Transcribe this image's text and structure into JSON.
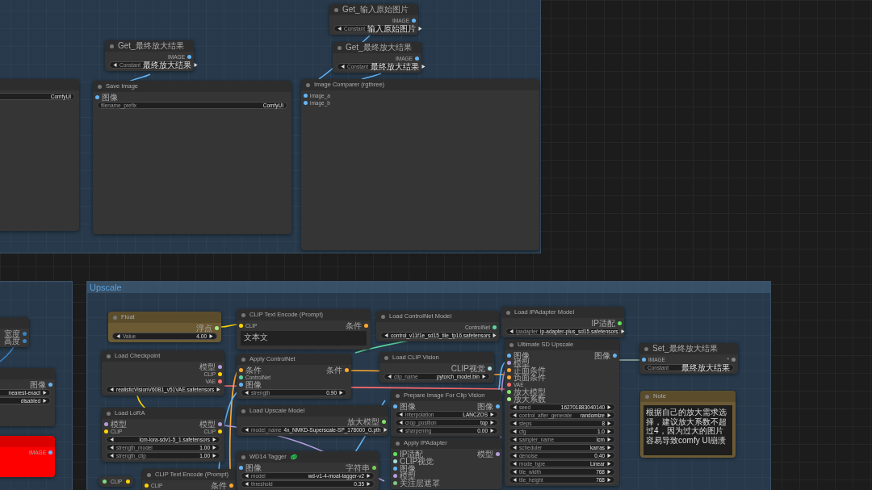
{
  "groups": [
    {
      "title": "Upscale"
    }
  ],
  "nodes": [
    {
      "kind": "node",
      "color": "#353535",
      "widgets": [
        {
          "kind": "text",
          "value": "ComfyUI"
        }
      ]
    },
    {
      "kind": "node",
      "title": "Get_最终放大结果",
      "color": "#353535",
      "outputs": [
        {
          "label": "IMAGE",
          "color": "#64b5f6"
        }
      ],
      "widgets": [
        {
          "kind": "combo",
          "name": "Constant",
          "value": "最终放大结果"
        }
      ]
    },
    {
      "kind": "node",
      "title": "Save Image",
      "color": "#353535",
      "inputs": [
        {
          "label": "图像",
          "color": "#64b5f6"
        }
      ],
      "widgets": [
        {
          "kind": "text",
          "name": "filename_prefix",
          "value": "ComfyUI"
        }
      ]
    },
    {
      "kind": "node",
      "title": "Get_输入原始图片",
      "color": "#353535",
      "outputs": [
        {
          "label": "IMAGE",
          "color": "#64b5f6"
        }
      ],
      "widgets": [
        {
          "kind": "combo",
          "name": "Constant",
          "value": "输入原始图片"
        }
      ]
    },
    {
      "kind": "node",
      "title": "Get_最终放大结果",
      "color": "#353535",
      "outputs": [
        {
          "label": "IMAGE",
          "color": "#64b5f6"
        }
      ],
      "widgets": [
        {
          "kind": "combo",
          "name": "Constant",
          "value": "最终放大结果"
        }
      ]
    },
    {
      "kind": "node",
      "title": "Image Comparer (rgthree)",
      "color": "#353535",
      "inputs": [
        {
          "label": "image_a",
          "color": "#64b5f6"
        },
        {
          "label": "image_b",
          "color": "#64b5f6"
        }
      ]
    },
    {
      "kind": "node",
      "color": "#353535",
      "outputs": [
        {
          "label": "宽度",
          "color": "#3b82c4"
        },
        {
          "label": "高度",
          "color": "#3b82c4"
        }
      ]
    },
    {
      "kind": "node",
      "color": "#353535",
      "outputs": [
        {
          "label": "图像",
          "color": "#64b5f6"
        }
      ],
      "widgets": [
        {
          "kind": "combo",
          "value": "nearest-exact"
        },
        {
          "kind": "combo",
          "value": "disabled"
        }
      ]
    },
    {
      "kind": "node",
      "color": "#ff0000",
      "outputs": [
        {
          "label": "IMAGE",
          "color": "#64b5f6"
        }
      ]
    },
    {
      "kind": "node",
      "title": "Float",
      "color": "#6b5a34",
      "outputs": [
        {
          "label": "浮点",
          "color": "#aaee88"
        }
      ],
      "widgets": [
        {
          "kind": "combo",
          "name": "Value",
          "value": "4.00"
        }
      ]
    },
    {
      "kind": "node",
      "title": "Load Checkpoint",
      "color": "#353535",
      "outputs": [
        {
          "label": "模型",
          "color": "#b39ddb"
        },
        {
          "label": "CLIP",
          "color": "#ffd500"
        },
        {
          "label": "VAE",
          "color": "#ff6e6e"
        }
      ],
      "widgets": [
        {
          "kind": "combo",
          "value": "realisticVisionV60B1_v51VAE.safetensors"
        }
      ]
    },
    {
      "kind": "node",
      "title": "Load LoRA",
      "color": "#353535",
      "inputs": [
        {
          "label": "模型",
          "color": "#b39ddb"
        },
        {
          "label": "CLIP",
          "color": "#ffd500"
        }
      ],
      "outputs": [
        {
          "label": "模型",
          "color": "#b39ddb"
        },
        {
          "label": "CLIP",
          "color": "#ffd500"
        }
      ],
      "widgets": [
        {
          "kind": "combo",
          "value": "lcm-lora-sdv1-5_1.safetensors"
        },
        {
          "kind": "combo",
          "name": "strength_model",
          "value": "1.00"
        },
        {
          "kind": "combo",
          "name": "strength_clip",
          "value": "1.00"
        }
      ]
    },
    {
      "kind": "reroute",
      "label": "CLIP",
      "inputs": [
        {
          "color": "#7fdc7f"
        }
      ],
      "outputs": [
        {
          "color": "#ffd500"
        }
      ]
    },
    {
      "kind": "node",
      "title": "CLIP Text Encode (Prompt)",
      "color": "#353535",
      "inputs": [
        {
          "label": "CLIP",
          "color": "#ffd500"
        }
      ],
      "outputs": [
        {
          "label": "条件",
          "color": "#ffa931"
        }
      ]
    },
    {
      "kind": "node",
      "title": "CLIP Text Encode (Prompt)",
      "color": "#353535",
      "inputs": [
        {
          "label": "CLIP",
          "color": "#ffd500"
        }
      ],
      "outputs": [
        {
          "label": "条件",
          "color": "#ffa931"
        }
      ],
      "widgets": [
        {
          "kind": "textarea",
          "value": "文本文"
        }
      ]
    },
    {
      "kind": "node",
      "title": "Apply ControlNet",
      "color": "#353535",
      "inputs": [
        {
          "label": "条件",
          "color": "#ffa931"
        },
        {
          "label": "ControlNet",
          "color": "#5fd3a0"
        },
        {
          "label": "图像",
          "color": "#64b5f6"
        }
      ],
      "outputs": [
        {
          "label": "条件",
          "color": "#ffa931"
        }
      ],
      "widgets": [
        {
          "kind": "combo",
          "name": "strength",
          "value": "0.90"
        }
      ]
    },
    {
      "kind": "node",
      "title": "Load Upscale Model",
      "color": "#353535",
      "outputs": [
        {
          "label": "放大模型",
          "color": "#7ee36a"
        }
      ],
      "widgets": [
        {
          "kind": "combo",
          "name": "model_name",
          "value": "4x_NMKD-Superscale-SP_178000_G.pth"
        }
      ]
    },
    {
      "kind": "node",
      "title": "WD14 Tagger",
      "badge": true,
      "color": "#353535",
      "inputs": [
        {
          "label": "图像",
          "color": "#64b5f6"
        }
      ],
      "outputs": [
        {
          "label": "字符串",
          "color": "#77cc55"
        }
      ],
      "widgets": [
        {
          "kind": "combo",
          "name": "model",
          "value": "wd-v1-4-moat-tagger-v2"
        },
        {
          "kind": "combo",
          "name": "threshold",
          "value": "0.35"
        }
      ]
    },
    {
      "kind": "node",
      "title": "Load ControlNet Model",
      "color": "#353535",
      "outputs": [
        {
          "label": "ControlNet",
          "color": "#5fd3a0"
        }
      ],
      "widgets": [
        {
          "kind": "combo",
          "value": "control_v11f1e_sd15_tile_fp16.safetensors"
        }
      ]
    },
    {
      "kind": "node",
      "title": "Load CLIP Vision",
      "color": "#353535",
      "outputs": [
        {
          "label": "CLIP视觉",
          "color": "#a8dadc"
        }
      ],
      "widgets": [
        {
          "kind": "combo",
          "name": "clip_name",
          "value": "pytorch_model.bin"
        }
      ]
    },
    {
      "kind": "node",
      "title": "Prepare Image For Clip Vision",
      "color": "#353535",
      "inputs": [
        {
          "label": "图像",
          "color": "#64b5f6"
        }
      ],
      "outputs": [
        {
          "label": "图像",
          "color": "#64b5f6"
        }
      ],
      "widgets": [
        {
          "kind": "combo",
          "name": "interpolation",
          "value": "LANCZOS"
        },
        {
          "kind": "combo",
          "name": "crop_position",
          "value": "top"
        },
        {
          "kind": "combo",
          "name": "sharpening",
          "value": "0.00"
        }
      ]
    },
    {
      "kind": "node",
      "title": "Apply IPAdapter",
      "color": "#353535",
      "inputs": [
        {
          "label": "IP适配",
          "color": "#5ee35e"
        },
        {
          "label": "CLIP视觉",
          "color": "#a8dadc"
        },
        {
          "label": "图像",
          "color": "#64b5f6"
        },
        {
          "label": "模型",
          "color": "#b39ddb"
        },
        {
          "label": "关注层遮罩",
          "color": "#81c784"
        }
      ],
      "outputs": [
        {
          "label": "模型",
          "color": "#b39ddb"
        }
      ]
    },
    {
      "kind": "node",
      "title": "Load IPAdapter Model",
      "color": "#353535",
      "outputs": [
        {
          "label": "IP适配",
          "color": "#5ee35e"
        }
      ],
      "widgets": [
        {
          "kind": "combo",
          "name": "ipadapter",
          "value": "ip-adapter-plus_sd15.safetensors"
        }
      ]
    },
    {
      "kind": "node",
      "title": "Ultimate SD Upscale",
      "color": "#353535",
      "inputs": [
        {
          "label": "图像",
          "color": "#64b5f6"
        },
        {
          "label": "模型",
          "color": "#b39ddb"
        },
        {
          "label": "正面条件",
          "color": "#ffa931"
        },
        {
          "label": "负面条件",
          "color": "#ffa931"
        },
        {
          "label": "VAE",
          "color": "#ff6e6e"
        },
        {
          "label": "放大模型",
          "color": "#7ee36a"
        },
        {
          "label": "放大系数",
          "color": "#aaee88"
        }
      ],
      "outputs": [
        {
          "label": "图像",
          "color": "#64b5f6"
        }
      ],
      "widgets": [
        {
          "kind": "combo",
          "name": "seed",
          "value": "162701883040140"
        },
        {
          "kind": "combo",
          "name": "control_after_generate",
          "value": "randomize"
        },
        {
          "kind": "combo",
          "name": "steps",
          "value": "8"
        },
        {
          "kind": "combo",
          "name": "cfg",
          "value": "1.0"
        },
        {
          "kind": "combo",
          "name": "sampler_name",
          "value": "lcm"
        },
        {
          "kind": "combo",
          "name": "scheduler",
          "value": "karras"
        },
        {
          "kind": "combo",
          "name": "denoise",
          "value": "0.40"
        },
        {
          "kind": "combo",
          "name": "mode_type",
          "value": "Linear"
        },
        {
          "kind": "combo",
          "name": "tile_width",
          "value": "768"
        },
        {
          "kind": "combo",
          "name": "tile_height",
          "value": "768"
        }
      ]
    },
    {
      "kind": "node",
      "title": "Set_最终放大结果",
      "color": "#353535",
      "inputs": [
        {
          "label": "IMAGE",
          "color": "#64b5f6"
        }
      ],
      "outputs": [
        {
          "label": "*",
          "color": "#888888"
        }
      ],
      "widgets": [
        {
          "kind": "text",
          "name": "Constant",
          "value": "最终放大结果"
        }
      ]
    },
    {
      "kind": "note",
      "title": "Note",
      "color": "#6b5a34",
      "text": "根据自己的放大需求选择，建议放大系数不超过4，因为过大的图片容易导致comfy UI崩溃"
    }
  ]
}
